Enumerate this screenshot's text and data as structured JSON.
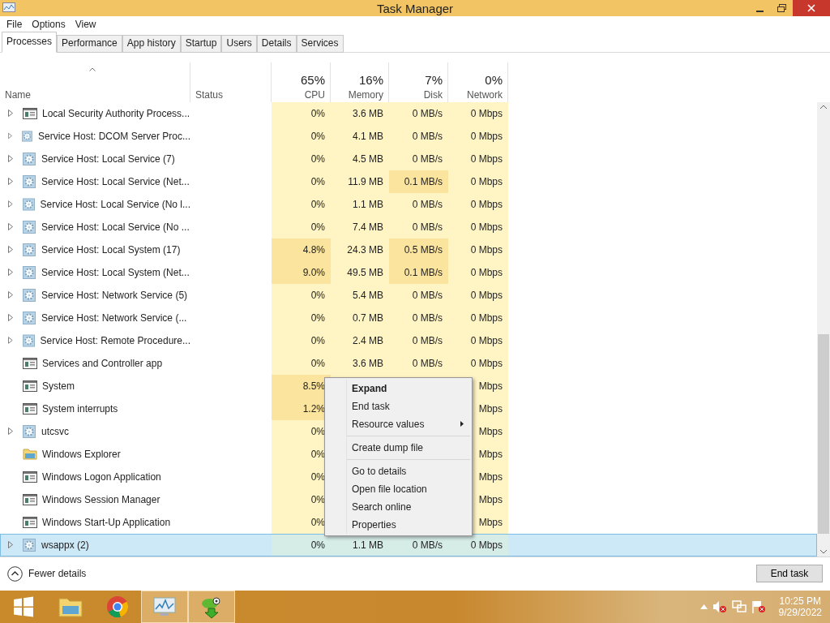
{
  "window": {
    "title": "Task Manager"
  },
  "menu_bar": [
    "File",
    "Options",
    "View"
  ],
  "tabs": [
    {
      "label": "Processes",
      "selected": true
    },
    {
      "label": "Performance",
      "selected": false
    },
    {
      "label": "App history",
      "selected": false
    },
    {
      "label": "Startup",
      "selected": false
    },
    {
      "label": "Users",
      "selected": false
    },
    {
      "label": "Details",
      "selected": false
    },
    {
      "label": "Services",
      "selected": false
    }
  ],
  "columns": {
    "name": {
      "label": "Name",
      "sorted": true
    },
    "status": {
      "label": "Status"
    },
    "cpu": {
      "percent": "65%",
      "label": "CPU"
    },
    "memory": {
      "percent": "16%",
      "label": "Memory"
    },
    "disk": {
      "percent": "7%",
      "label": "Disk"
    },
    "network": {
      "percent": "0%",
      "label": "Network"
    }
  },
  "rows": [
    {
      "name": "Local Security Authority Process...",
      "kind": "window",
      "expandable": true,
      "selected": false,
      "cpu": "0%",
      "memory": "3.6 MB",
      "disk": "0 MB/s",
      "network": "0 Mbps",
      "cpu_high": false,
      "disk_high": false
    },
    {
      "name": "Service Host: DCOM Server Proc...",
      "kind": "gear",
      "expandable": true,
      "selected": false,
      "cpu": "0%",
      "memory": "4.1 MB",
      "disk": "0 MB/s",
      "network": "0 Mbps",
      "cpu_high": false,
      "disk_high": false
    },
    {
      "name": "Service Host: Local Service (7)",
      "kind": "gear",
      "expandable": true,
      "selected": false,
      "cpu": "0%",
      "memory": "4.5 MB",
      "disk": "0 MB/s",
      "network": "0 Mbps",
      "cpu_high": false,
      "disk_high": false
    },
    {
      "name": "Service Host: Local Service (Net...",
      "kind": "gear",
      "expandable": true,
      "selected": false,
      "cpu": "0%",
      "memory": "11.9 MB",
      "disk": "0.1 MB/s",
      "network": "0 Mbps",
      "cpu_high": false,
      "disk_high": true
    },
    {
      "name": "Service Host: Local Service (No l...",
      "kind": "gear",
      "expandable": true,
      "selected": false,
      "cpu": "0%",
      "memory": "1.1 MB",
      "disk": "0 MB/s",
      "network": "0 Mbps",
      "cpu_high": false,
      "disk_high": false
    },
    {
      "name": "Service Host: Local Service (No ...",
      "kind": "gear",
      "expandable": true,
      "selected": false,
      "cpu": "0%",
      "memory": "7.4 MB",
      "disk": "0 MB/s",
      "network": "0 Mbps",
      "cpu_high": false,
      "disk_high": false
    },
    {
      "name": "Service Host: Local System (17)",
      "kind": "gear",
      "expandable": true,
      "selected": false,
      "cpu": "4.8%",
      "memory": "24.3 MB",
      "disk": "0.5 MB/s",
      "network": "0 Mbps",
      "cpu_high": true,
      "disk_high": true
    },
    {
      "name": "Service Host: Local System (Net...",
      "kind": "gear",
      "expandable": true,
      "selected": false,
      "cpu": "9.0%",
      "memory": "49.5 MB",
      "disk": "0.1 MB/s",
      "network": "0 Mbps",
      "cpu_high": true,
      "disk_high": true
    },
    {
      "name": "Service Host: Network Service (5)",
      "kind": "gear",
      "expandable": true,
      "selected": false,
      "cpu": "0%",
      "memory": "5.4 MB",
      "disk": "0 MB/s",
      "network": "0 Mbps",
      "cpu_high": false,
      "disk_high": false
    },
    {
      "name": "Service Host: Network Service (...",
      "kind": "gear",
      "expandable": true,
      "selected": false,
      "cpu": "0%",
      "memory": "0.7 MB",
      "disk": "0 MB/s",
      "network": "0 Mbps",
      "cpu_high": false,
      "disk_high": false
    },
    {
      "name": "Service Host: Remote Procedure...",
      "kind": "gear",
      "expandable": true,
      "selected": false,
      "cpu": "0%",
      "memory": "2.4 MB",
      "disk": "0 MB/s",
      "network": "0 Mbps",
      "cpu_high": false,
      "disk_high": false
    },
    {
      "name": "Services and Controller app",
      "kind": "window",
      "expandable": false,
      "selected": false,
      "cpu": "0%",
      "memory": "3.6 MB",
      "disk": "0 MB/s",
      "network": "0 Mbps",
      "cpu_high": false,
      "disk_high": false
    },
    {
      "name": "System",
      "kind": "window",
      "expandable": false,
      "selected": false,
      "cpu": "8.5%",
      "network": "Mbps",
      "cpu_high": true
    },
    {
      "name": "System interrupts",
      "kind": "window",
      "expandable": false,
      "selected": false,
      "cpu": "1.2%",
      "network": "Mbps",
      "cpu_high": true
    },
    {
      "name": "utcsvc",
      "kind": "gear",
      "expandable": true,
      "selected": false,
      "cpu": "0%",
      "network": "Mbps",
      "cpu_high": false
    },
    {
      "name": "Windows Explorer",
      "kind": "folder",
      "expandable": false,
      "selected": false,
      "cpu": "0%",
      "network": "Mbps",
      "cpu_high": false
    },
    {
      "name": "Windows Logon Application",
      "kind": "window",
      "expandable": false,
      "selected": false,
      "cpu": "0%",
      "network": "Mbps",
      "cpu_high": false
    },
    {
      "name": "Windows Session Manager",
      "kind": "window",
      "expandable": false,
      "selected": false,
      "cpu": "0%",
      "network": "Mbps",
      "cpu_high": false
    },
    {
      "name": "Windows Start-Up Application",
      "kind": "window",
      "expandable": false,
      "selected": false,
      "cpu": "0%",
      "network": "Mbps",
      "cpu_high": false
    },
    {
      "name": "wsappx (2)",
      "kind": "gear",
      "expandable": true,
      "selected": true,
      "cpu": "0%",
      "memory": "1.1 MB",
      "disk": "0 MB/s",
      "network": "0 Mbps",
      "cpu_high": false,
      "disk_high": false
    }
  ],
  "context_menu": [
    {
      "kind": "item",
      "label": "Expand",
      "default": true,
      "submenu": false
    },
    {
      "kind": "item",
      "label": "End task",
      "default": false,
      "submenu": false
    },
    {
      "kind": "item",
      "label": "Resource values",
      "default": false,
      "submenu": true
    },
    {
      "kind": "separator"
    },
    {
      "kind": "item",
      "label": "Create dump file",
      "default": false,
      "submenu": false
    },
    {
      "kind": "separator"
    },
    {
      "kind": "item",
      "label": "Go to details",
      "default": false,
      "submenu": false
    },
    {
      "kind": "item",
      "label": "Open file location",
      "default": false,
      "submenu": false
    },
    {
      "kind": "item",
      "label": "Search online",
      "default": false,
      "submenu": false
    },
    {
      "kind": "item",
      "label": "Properties",
      "default": false,
      "submenu": false
    }
  ],
  "footer": {
    "details_toggle": "Fewer details",
    "end_task": "End task"
  },
  "taskbar": {
    "apps": [
      {
        "kind": "explorer",
        "active": false
      },
      {
        "kind": "browser",
        "active": false
      },
      {
        "kind": "taskmgr",
        "active": true
      },
      {
        "kind": "chameleon",
        "active": true
      }
    ],
    "time": "10:25 PM",
    "date": "9/29/2022"
  }
}
